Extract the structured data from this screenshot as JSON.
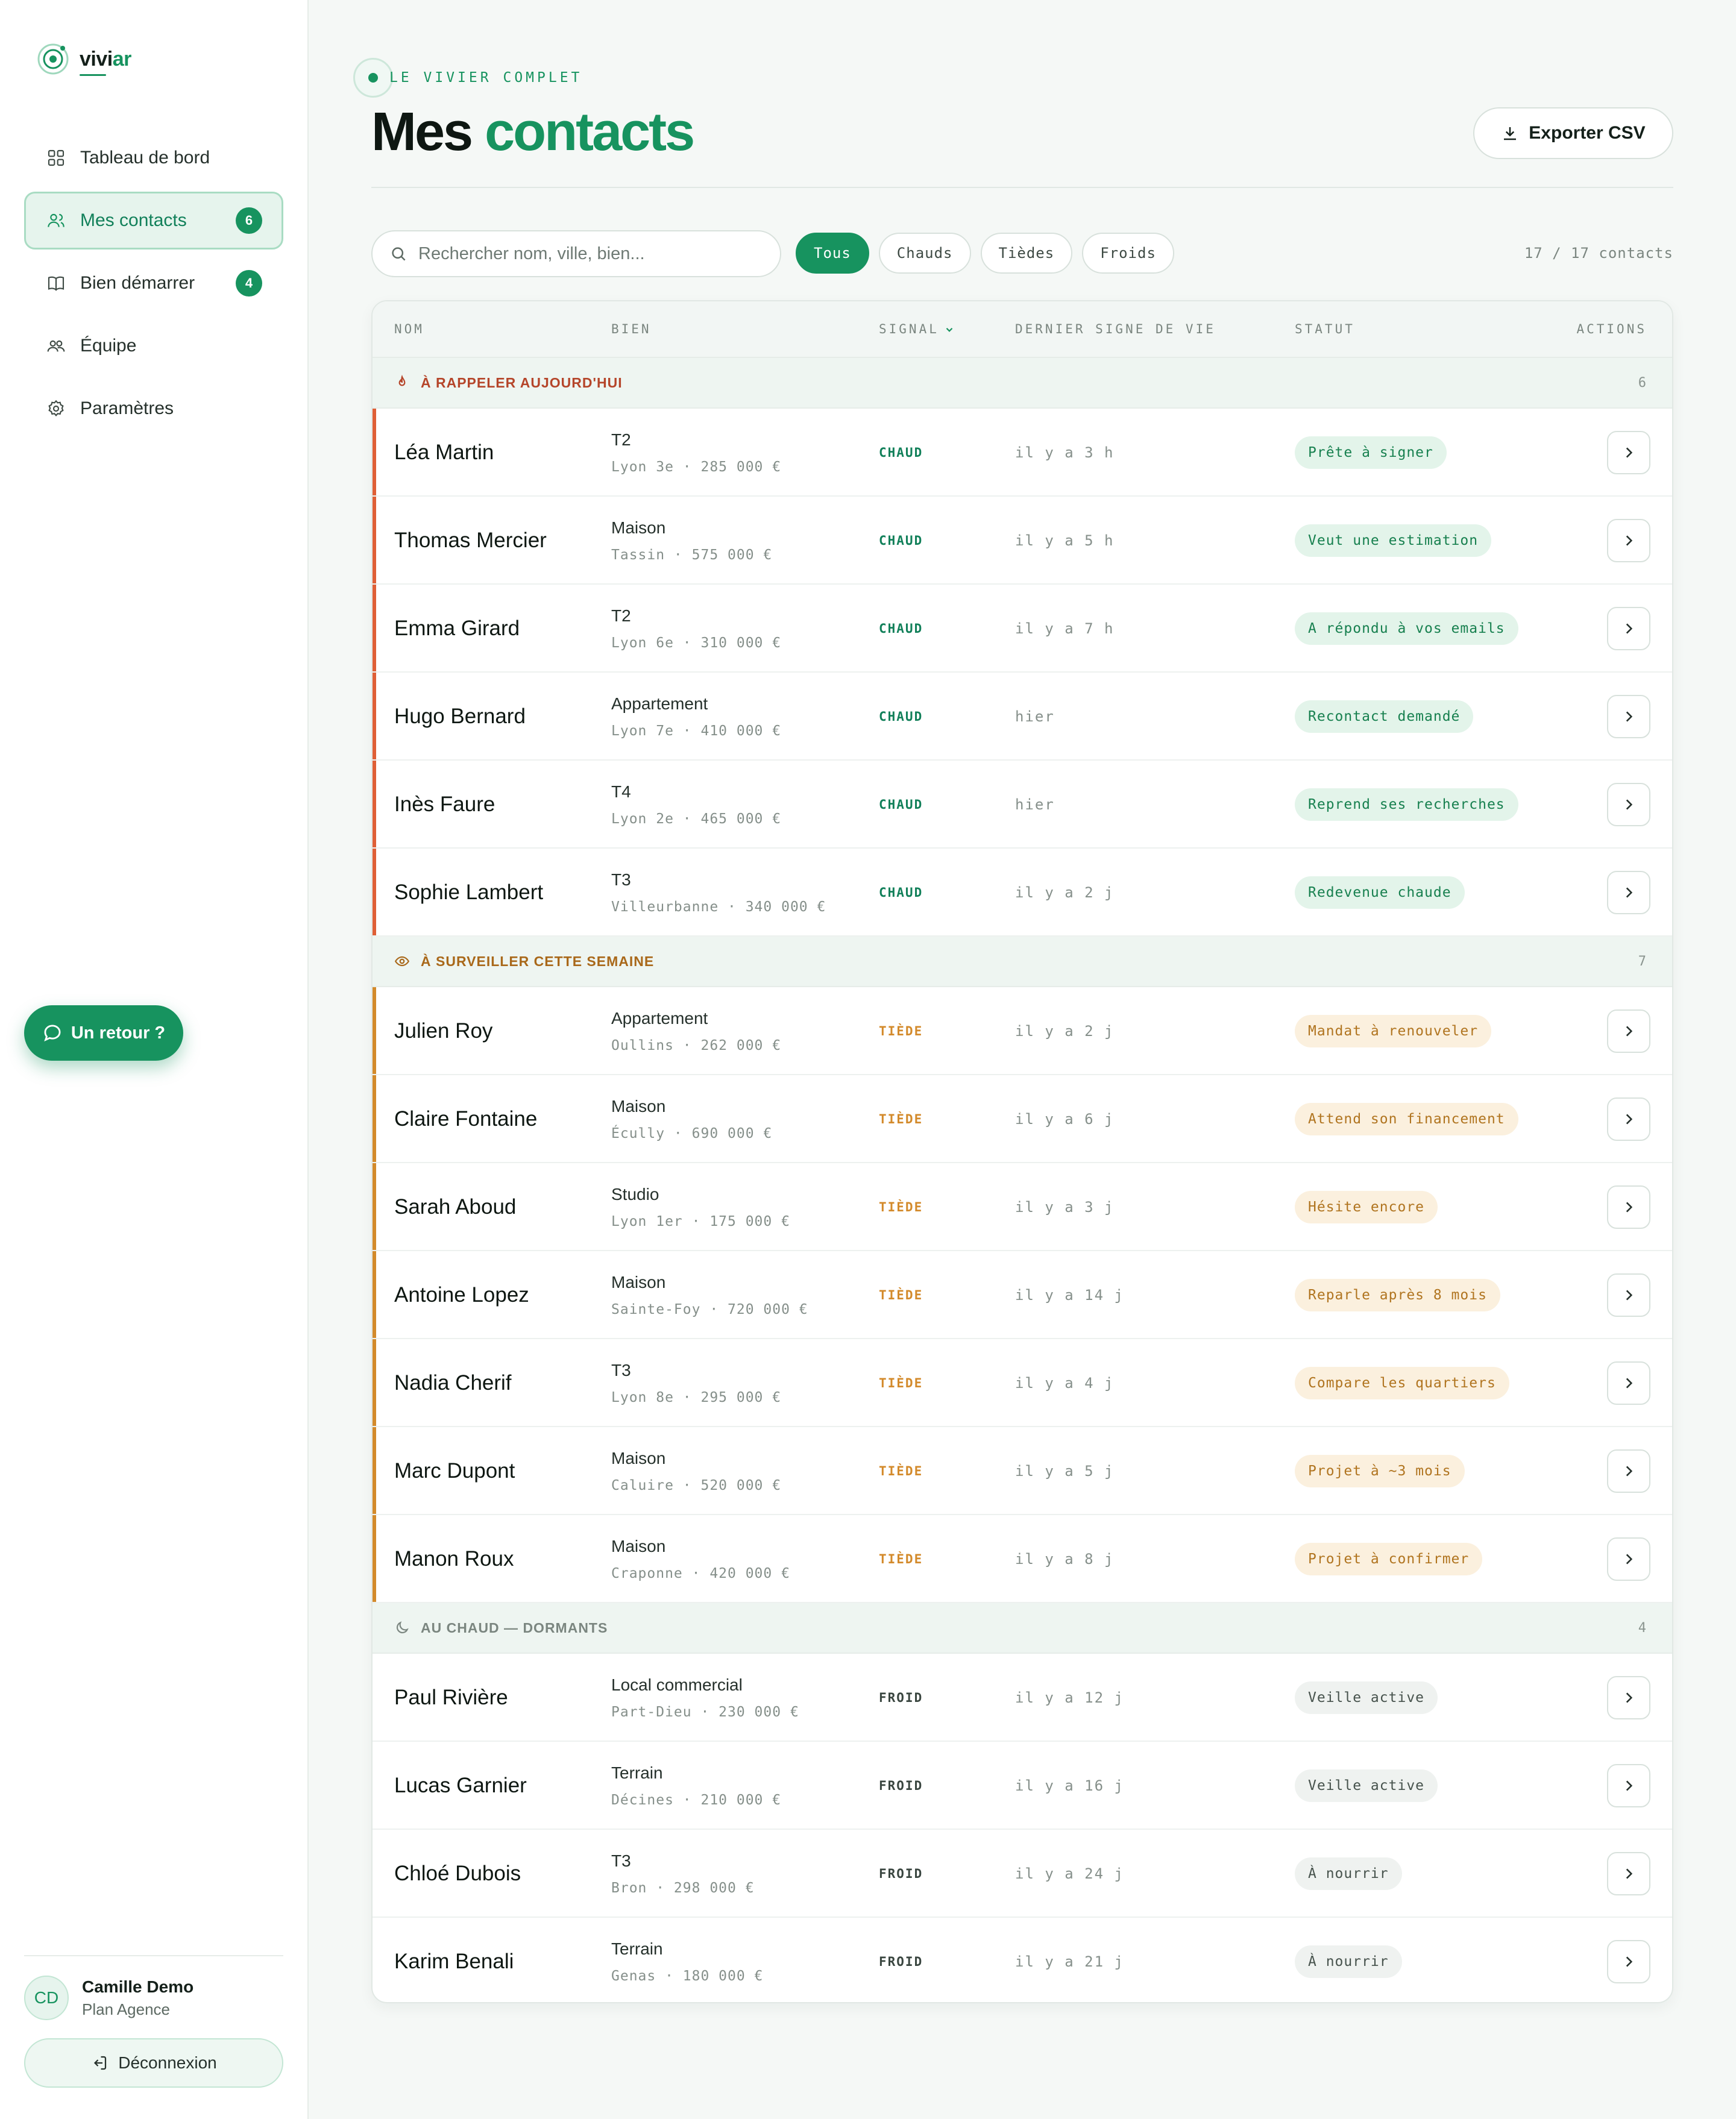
{
  "app": {
    "logo_prefix": "vivi",
    "logo_suffix": "ar"
  },
  "sidebar": {
    "items": [
      {
        "label": "Tableau de bord",
        "icon": "grid-icon",
        "badge": ""
      },
      {
        "label": "Mes contacts",
        "icon": "users-icon",
        "badge": "6"
      },
      {
        "label": "Bien démarrer",
        "icon": "book-icon",
        "badge": "4"
      },
      {
        "label": "Équipe",
        "icon": "team-icon",
        "badge": ""
      },
      {
        "label": "Paramètres",
        "icon": "gear-icon",
        "badge": ""
      }
    ],
    "feedback_label": "Un retour ?",
    "user": {
      "initials": "CD",
      "name": "Camille Demo",
      "plan": "Plan Agence"
    },
    "logout_label": "Déconnexion"
  },
  "header": {
    "eyebrow": "LE VIVIER COMPLET",
    "title_part1": "Mes",
    "title_part2": "contacts",
    "export_label": "Exporter CSV"
  },
  "toolbar": {
    "search_placeholder": "Rechercher nom, ville, bien...",
    "filters": [
      "Tous",
      "Chauds",
      "Tièdes",
      "Froids"
    ],
    "active_filter": "Tous",
    "count": "17 / 17 contacts"
  },
  "table": {
    "columns": {
      "name": "NOM",
      "bien": "BIEN",
      "signal": "SIGNAL",
      "seen": "DERNIER SIGNE DE VIE",
      "status": "STATUT",
      "actions": "ACTIONS"
    },
    "groups": [
      {
        "label": "À RAPPELER AUJOURD'HUI",
        "icon": "flame-icon",
        "color": "#b5452a",
        "count": "6",
        "kind": "hot",
        "rows": [
          {
            "name": "Léa Martin",
            "type": "T2",
            "loc": "Lyon 3e · 285 000 €",
            "signal": "CHAUD",
            "seen": "il y a 3 h",
            "status": "Prête à signer"
          },
          {
            "name": "Thomas Mercier",
            "type": "Maison",
            "loc": "Tassin · 575 000 €",
            "signal": "CHAUD",
            "seen": "il y a 5 h",
            "status": "Veut une estimation"
          },
          {
            "name": "Emma Girard",
            "type": "T2",
            "loc": "Lyon 6e · 310 000 €",
            "signal": "CHAUD",
            "seen": "il y a 7 h",
            "status": "A répondu à vos emails"
          },
          {
            "name": "Hugo Bernard",
            "type": "Appartement",
            "loc": "Lyon 7e · 410 000 €",
            "signal": "CHAUD",
            "seen": "hier",
            "status": "Recontact demandé"
          },
          {
            "name": "Inès Faure",
            "type": "T4",
            "loc": "Lyon 2e · 465 000 €",
            "signal": "CHAUD",
            "seen": "hier",
            "status": "Reprend ses recherches"
          },
          {
            "name": "Sophie Lambert",
            "type": "T3",
            "loc": "Villeurbanne · 340 000 €",
            "signal": "CHAUD",
            "seen": "il y a 2 j",
            "status": "Redevenue chaude"
          }
        ]
      },
      {
        "label": "À SURVEILLER CETTE SEMAINE",
        "icon": "eye-icon",
        "color": "#a9681a",
        "count": "7",
        "kind": "warm",
        "rows": [
          {
            "name": "Julien Roy",
            "type": "Appartement",
            "loc": "Oullins · 262 000 €",
            "signal": "TIÈDE",
            "seen": "il y a 2 j",
            "status": "Mandat à renouveler"
          },
          {
            "name": "Claire Fontaine",
            "type": "Maison",
            "loc": "Écully · 690 000 €",
            "signal": "TIÈDE",
            "seen": "il y a 6 j",
            "status": "Attend son financement"
          },
          {
            "name": "Sarah Aboud",
            "type": "Studio",
            "loc": "Lyon 1er · 175 000 €",
            "signal": "TIÈDE",
            "seen": "il y a 3 j",
            "status": "Hésite encore"
          },
          {
            "name": "Antoine Lopez",
            "type": "Maison",
            "loc": "Sainte-Foy · 720 000 €",
            "signal": "TIÈDE",
            "seen": "il y a 14 j",
            "status": "Reparle après 8 mois"
          },
          {
            "name": "Nadia Cherif",
            "type": "T3",
            "loc": "Lyon 8e · 295 000 €",
            "signal": "TIÈDE",
            "seen": "il y a 4 j",
            "status": "Compare les quartiers"
          },
          {
            "name": "Marc Dupont",
            "type": "Maison",
            "loc": "Caluire · 520 000 €",
            "signal": "TIÈDE",
            "seen": "il y a 5 j",
            "status": "Projet à ~3 mois"
          },
          {
            "name": "Manon Roux",
            "type": "Maison",
            "loc": "Craponne · 420 000 €",
            "signal": "TIÈDE",
            "seen": "il y a 8 j",
            "status": "Projet à confirmer"
          }
        ]
      },
      {
        "label": "AU CHAUD — DORMANTS",
        "icon": "moon-icon",
        "color": "#7b8680",
        "count": "4",
        "kind": "cold",
        "rows": [
          {
            "name": "Paul Rivière",
            "type": "Local commercial",
            "loc": "Part-Dieu · 230 000 €",
            "signal": "FROID",
            "seen": "il y a 12 j",
            "status": "Veille active"
          },
          {
            "name": "Lucas Garnier",
            "type": "Terrain",
            "loc": "Décines · 210 000 €",
            "signal": "FROID",
            "seen": "il y a 16 j",
            "status": "Veille active"
          },
          {
            "name": "Chloé Dubois",
            "type": "T3",
            "loc": "Bron · 298 000 €",
            "signal": "FROID",
            "seen": "il y a 24 j",
            "status": "À nourrir"
          },
          {
            "name": "Karim Benali",
            "type": "Terrain",
            "loc": "Genas · 180 000 €",
            "signal": "FROID",
            "seen": "il y a 21 j",
            "status": "À nourrir"
          }
        ]
      }
    ]
  },
  "colors": {
    "accent": "#17935f",
    "hot": "#df5f36",
    "warm": "#d38a2b"
  }
}
